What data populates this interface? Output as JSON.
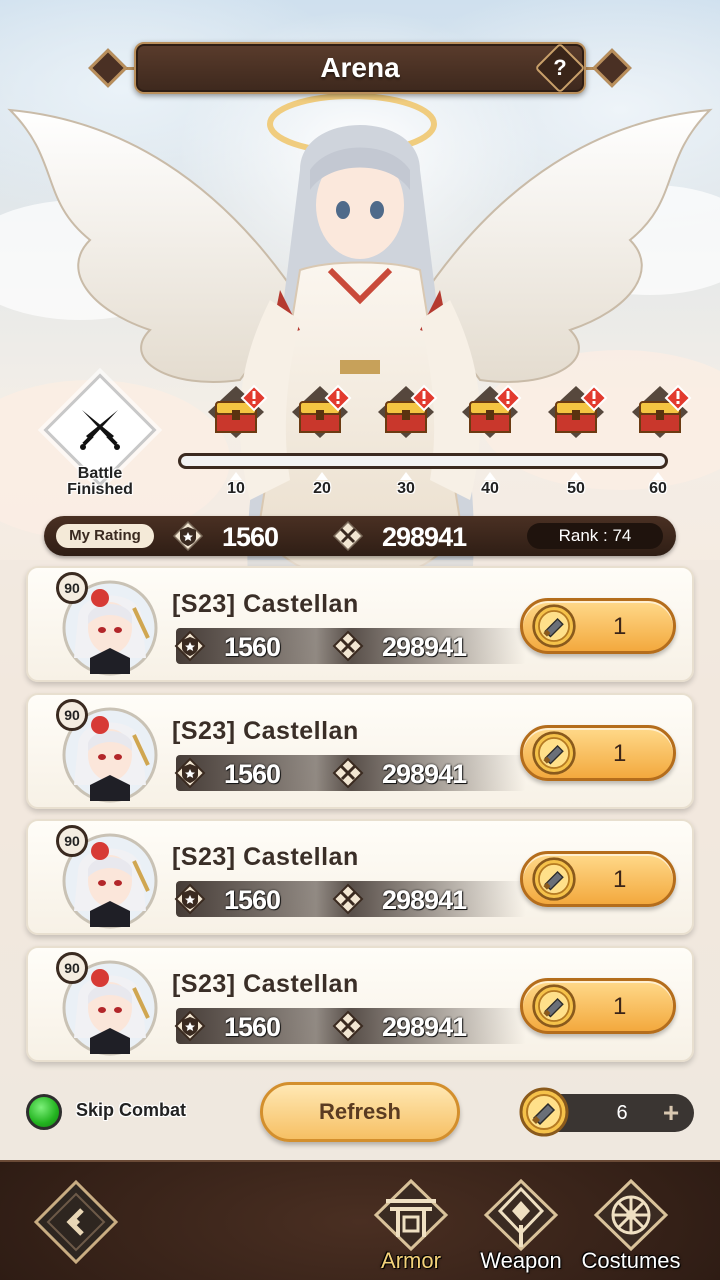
{
  "header": {
    "title": "Arena",
    "help_label": "?"
  },
  "battle_status": {
    "label_line1": "Battle",
    "label_line2": "Finished"
  },
  "progress": {
    "value": 0,
    "milestones": [
      "10",
      "20",
      "30",
      "40",
      "50",
      "60"
    ],
    "chest_count": 6
  },
  "my_rating": {
    "label": "My Rating",
    "rating": "1560",
    "power": "298941",
    "rank": "Rank : 74"
  },
  "opponents": [
    {
      "level": "90",
      "name": "[S23] Castellan",
      "rating": "1560",
      "power": "298941",
      "cost": "1"
    },
    {
      "level": "90",
      "name": "[S23] Castellan",
      "rating": "1560",
      "power": "298941",
      "cost": "1"
    },
    {
      "level": "90",
      "name": "[S23] Castellan",
      "rating": "1560",
      "power": "298941",
      "cost": "1"
    },
    {
      "level": "90",
      "name": "[S23] Castellan",
      "rating": "1560",
      "power": "298941",
      "cost": "1"
    }
  ],
  "actions": {
    "skip_label": "Skip Combat",
    "skip_on": true,
    "refresh_label": "Refresh",
    "tickets": "6",
    "add_label": "+"
  },
  "nav": {
    "items": [
      {
        "label": "Armor",
        "icon": "torii-gate-icon",
        "active": true
      },
      {
        "label": "Weapon",
        "icon": "weapon-emblem-icon",
        "active": false
      },
      {
        "label": "Costumes",
        "icon": "costume-emblem-icon",
        "active": false
      }
    ]
  },
  "colors": {
    "accent_gold": "#f3a93e",
    "panel_brown": "#3d281d",
    "toggle_green": "#22b31f"
  }
}
